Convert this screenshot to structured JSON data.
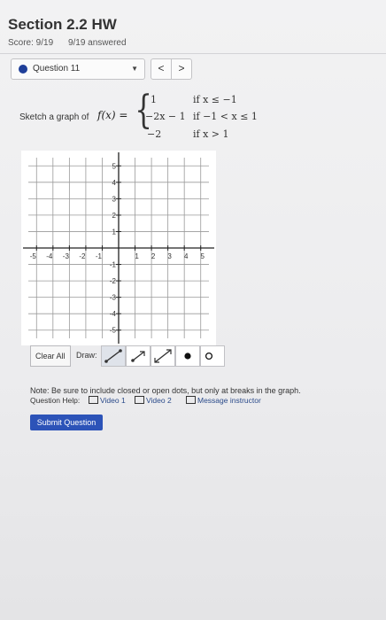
{
  "header": {
    "title": "Section 2.2 HW",
    "score": "Score: 9/19",
    "answered": "9/19 answered"
  },
  "question_nav": {
    "label": "Question 11",
    "prev": "<",
    "next": ">"
  },
  "question": {
    "prompt": "Sketch a graph of",
    "function": "f(x) =",
    "pieces": [
      {
        "value": "1",
        "condition": "if x ≤ −1"
      },
      {
        "value": "−2x − 1",
        "condition": "if −1 < x ≤ 1"
      },
      {
        "value": "−2",
        "condition": "if x > 1"
      }
    ]
  },
  "graph": {
    "x_ticks": [
      "-5",
      "-4",
      "-3",
      "-2",
      "-1",
      "1",
      "2",
      "3",
      "4",
      "5"
    ],
    "y_ticks": [
      "5",
      "4",
      "3",
      "2",
      "1",
      "-1",
      "-2",
      "-3",
      "-4",
      "-5"
    ]
  },
  "toolbar": {
    "clear_label": "Clear All",
    "draw_label": "Draw:",
    "tools": [
      "line-segment-icon",
      "ray-icon",
      "line-icon",
      "closed-dot-icon",
      "open-dot-icon"
    ]
  },
  "note": "Note: Be sure to include closed or open dots, but only at breaks in the graph.",
  "help": {
    "label": "Question Help:",
    "video1": "Video 1",
    "video2": "Video 2",
    "message": "Message instructor"
  },
  "submit_label": "Submit Question",
  "colors": {
    "accent": "#2c53b8",
    "nav_dot": "#1f3f99"
  }
}
